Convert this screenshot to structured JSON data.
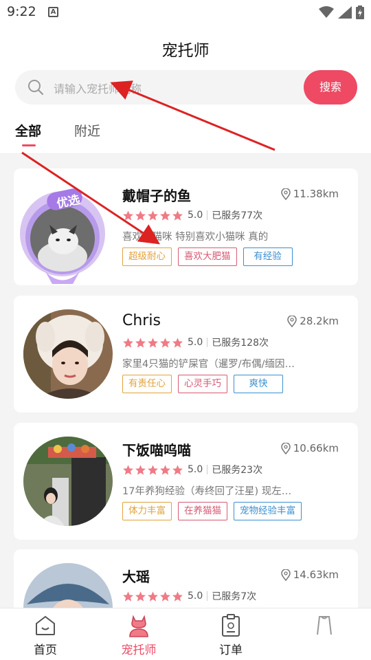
{
  "status_bar": {
    "time": "9:22",
    "notification_letter": "A"
  },
  "page": {
    "title": "宠托师"
  },
  "search": {
    "placeholder": "请输入宠托师昵称",
    "button_label": "搜索"
  },
  "tabs": [
    {
      "label": "全部",
      "active": true
    },
    {
      "label": "附近",
      "active": false
    }
  ],
  "sitters": [
    {
      "name": "戴帽子的鱼",
      "distance": "11.38km",
      "rating": "5.0",
      "served": "已服务77次",
      "desc": "喜欢小猫咪 特别喜欢小猫咪 真的",
      "badge": "优选",
      "tags": [
        "超级耐心",
        "喜欢大肥猫",
        "有经验"
      ]
    },
    {
      "name": "Chris",
      "distance": "28.2km",
      "rating": "5.0",
      "served": "已服务128次",
      "desc": "家里4只猫的铲屎官（暹罗/布偶/缅因…",
      "tags": [
        "有责任心",
        "心灵手巧",
        "爽快"
      ]
    },
    {
      "name": "下饭喵呜喵",
      "distance": "10.66km",
      "rating": "5.0",
      "served": "已服务23次",
      "desc": "17年养狗经验（寿终回了汪星) 现左…",
      "tags": [
        "体力丰富",
        "在养猫猫",
        "宠物经验丰富"
      ]
    },
    {
      "name": "大瑶",
      "distance": "14.63km",
      "rating": "5.0",
      "served": "已服务7次",
      "desc": "",
      "tags": []
    }
  ],
  "tabbar": [
    {
      "label": "首页",
      "icon": "home-icon",
      "active": false
    },
    {
      "label": "宠托师",
      "icon": "sitter-icon",
      "active": true
    },
    {
      "label": "订单",
      "icon": "order-icon",
      "active": false
    },
    {
      "label": "",
      "icon": "profile-icon",
      "active": false
    }
  ],
  "colors": {
    "accent": "#ee4a64",
    "star": "#f07a86",
    "tag_yellow": "#e2a23a",
    "tag_red": "#d85a72",
    "tag_blue": "#3a8fcf"
  }
}
